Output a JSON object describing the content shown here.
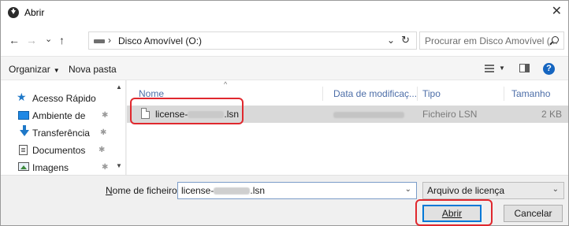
{
  "window": {
    "title": "Abrir",
    "close_glyph": "✕"
  },
  "address": {
    "back_glyph": "←",
    "forward_glyph": "→",
    "recent_glyph": "⌄",
    "up_glyph": "↑",
    "separator": "›",
    "path": "Disco Amovível (O:)",
    "chevron": "⌄",
    "refresh_glyph": "↻",
    "search_placeholder": "Procurar em Disco Amovível (..."
  },
  "toolbar": {
    "organize": "Organizar",
    "organize_caret": "▼",
    "new_folder": "Nova pasta",
    "view_caret": "▼",
    "help": "?"
  },
  "nav_pane": {
    "items": [
      {
        "label": "Acesso Rápido",
        "icon": "star-icon",
        "pinned": false
      },
      {
        "label": "Ambiente de",
        "icon": "desktop-icon",
        "pinned": true
      },
      {
        "label": "Transferência",
        "icon": "download-icon",
        "pinned": true
      },
      {
        "label": "Documentos",
        "icon": "documents-icon",
        "pinned": true
      },
      {
        "label": "Imagens",
        "icon": "pictures-icon",
        "pinned": true
      }
    ],
    "pin_glyph": "✱",
    "scroll_up": "▲",
    "scroll_down": "▼",
    "sort_glyph": "^"
  },
  "file_list": {
    "columns": [
      "Nome",
      "Data de modificaç...",
      "Tipo",
      "Tamanho"
    ],
    "rows": [
      {
        "name_prefix": "license-",
        "name_suffix": ".lsn",
        "type": "Ficheiro LSN",
        "size": "2 KB"
      }
    ]
  },
  "bottom": {
    "filename_label": "Nome de ficheiro:",
    "filename_prefix": "license-",
    "filename_suffix": ".lsn",
    "filter_value": "Arquivo de licença",
    "chevron": "⌄",
    "open_label": "Abrir",
    "cancel_label": "Cancelar"
  },
  "colors": {
    "highlight": "#e0282e",
    "accent": "#0078d7"
  }
}
